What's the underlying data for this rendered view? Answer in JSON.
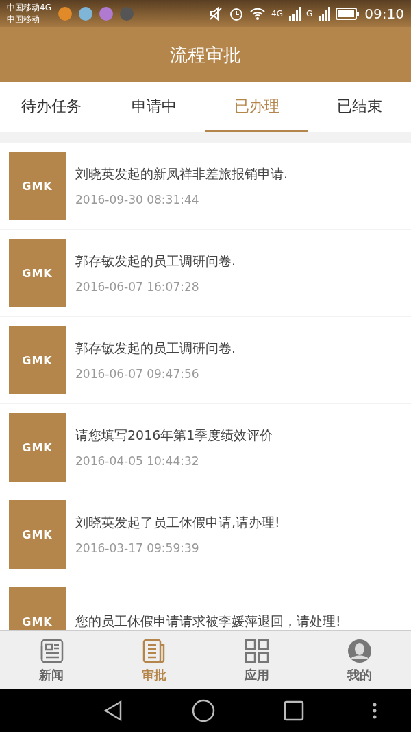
{
  "status_bar": {
    "carriers": [
      "中国移动4G",
      "中国移动"
    ],
    "network_labels": [
      "4G",
      "G"
    ],
    "time": "09:10"
  },
  "header": {
    "title": "流程审批"
  },
  "tabs": [
    {
      "label": "待办任务",
      "selected": false
    },
    {
      "label": "申请中",
      "selected": false
    },
    {
      "label": "已办理",
      "selected": true
    },
    {
      "label": "已结束",
      "selected": false
    }
  ],
  "items": [
    {
      "logo": "GMK",
      "title": "刘晓英发起的新凤祥非差旅报销申请.",
      "date": "2016-09-30 08:31:44"
    },
    {
      "logo": "GMK",
      "title": "郭存敏发起的员工调研问卷.",
      "date": "2016-06-07 16:07:28"
    },
    {
      "logo": "GMK",
      "title": "郭存敏发起的员工调研问卷.",
      "date": "2016-06-07 09:47:56"
    },
    {
      "logo": "GMK",
      "title": "请您填写2016年第1季度绩效评价",
      "date": "2016-04-05 10:44:32"
    },
    {
      "logo": "GMK",
      "title": "刘晓英发起了员工休假申请,请办理!",
      "date": "2016-03-17 09:59:39"
    },
    {
      "logo": "GMK",
      "title": "您的员工休假申请请求被李媛萍退回，请处理!"
    }
  ],
  "bottom_nav": [
    {
      "kind": "news",
      "label": "新闻",
      "selected": false
    },
    {
      "kind": "approval",
      "label": "审批",
      "selected": true
    },
    {
      "kind": "apps",
      "label": "应用",
      "selected": false
    },
    {
      "kind": "profile",
      "label": "我的",
      "selected": false
    }
  ]
}
